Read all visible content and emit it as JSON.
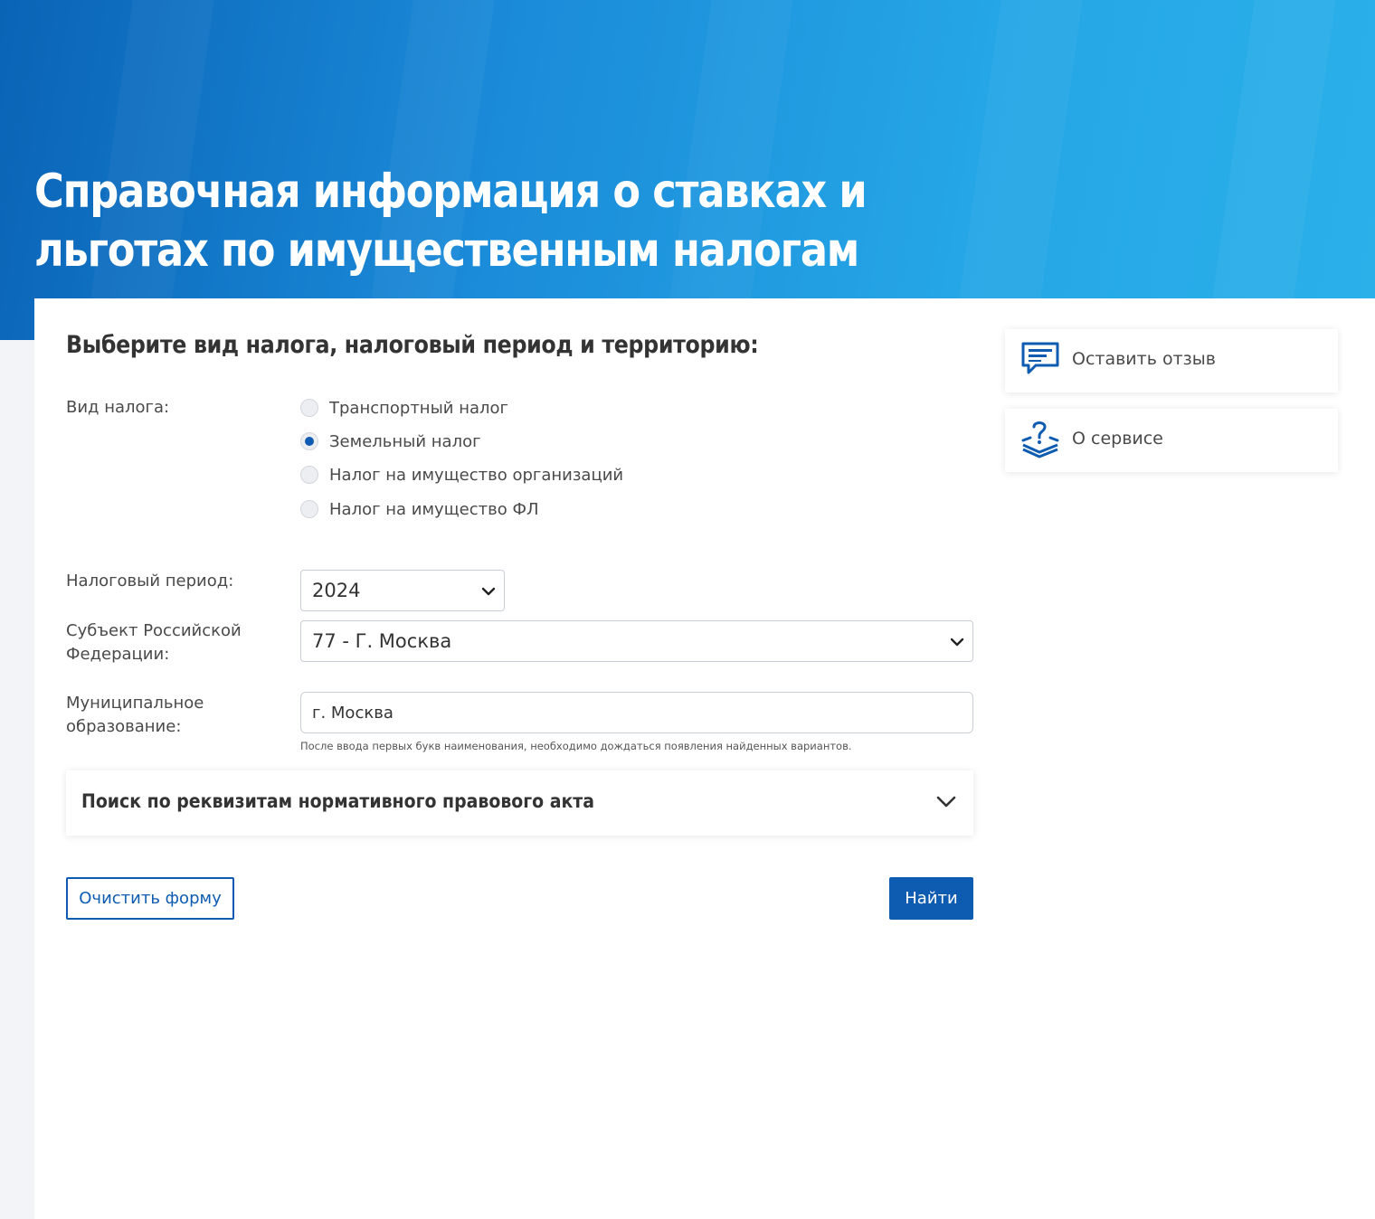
{
  "page": {
    "title": "Справочная информация о ставках и льготах по имущественным налогам"
  },
  "form": {
    "heading": "Выберите вид налога, налоговый период и территорию:",
    "tax_type": {
      "label": "Вид налога:",
      "options": [
        {
          "label": "Транспортный налог",
          "selected": false
        },
        {
          "label": "Земельный налог",
          "selected": true
        },
        {
          "label": "Налог на имущество организаций",
          "selected": false
        },
        {
          "label": "Налог на имущество ФЛ",
          "selected": false
        }
      ]
    },
    "period": {
      "label": "Налоговый период:",
      "value": "2024"
    },
    "region": {
      "label_line1": "Субъект Российской",
      "label_line2": "Федерации:",
      "value": "77 - Г. Москва"
    },
    "municipality": {
      "label_line1": "Муниципальное",
      "label_line2": "образование:",
      "value": "г. Москва",
      "hint": "После ввода первых букв наименования, необходимо дождаться появления найденных вариантов."
    },
    "accordion": {
      "title": "Поиск по реквизитам нормативного правового акта",
      "icon": "chevron-down-icon"
    },
    "clear_label": "Очистить форму",
    "find_label": "Найти"
  },
  "sidebar": {
    "feedback": {
      "label": "Оставить отзыв",
      "icon": "speech-bubble-icon"
    },
    "about": {
      "label": "О сервисе",
      "icon": "question-book-icon"
    }
  },
  "colors": {
    "brand": "#0e5cb1",
    "hero_start": "#0a63b6",
    "hero_end": "#2bb0ea"
  }
}
